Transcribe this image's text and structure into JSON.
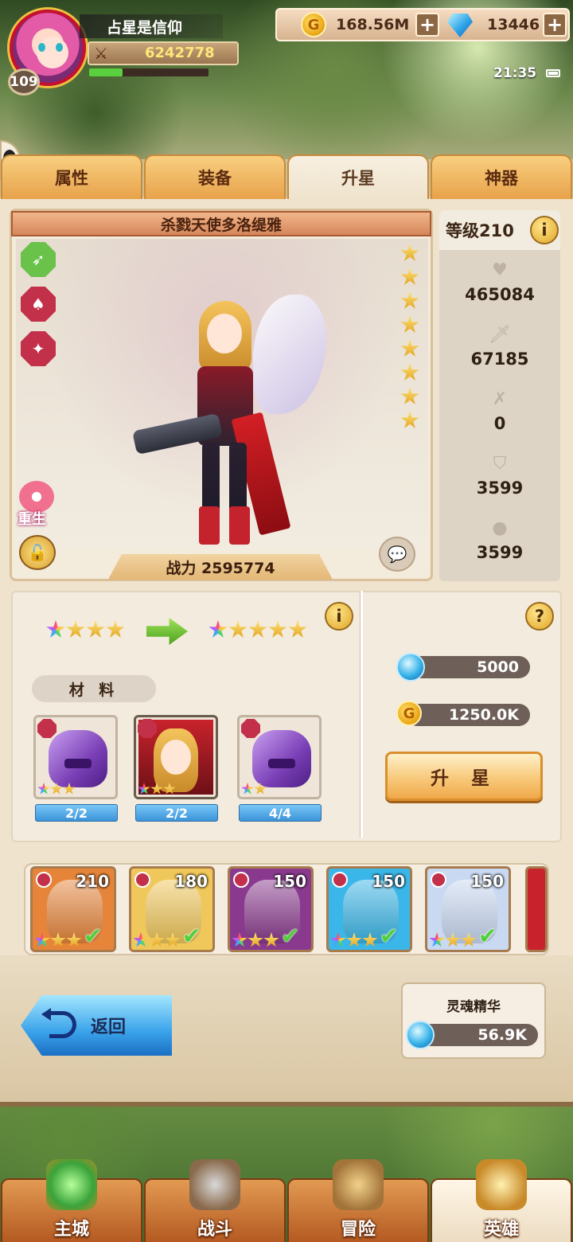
{
  "header": {
    "player_name": "占星是信仰",
    "player_level": "109",
    "combat_power": "6242778",
    "exp_progress": 0.28,
    "gold": "168.56M",
    "gems": "13446",
    "time": "21:35"
  },
  "tabs": [
    {
      "label": "属性"
    },
    {
      "label": "装备"
    },
    {
      "label": "升星"
    },
    {
      "label": "神器"
    }
  ],
  "active_tab": "升星",
  "hero": {
    "name": "杀戮天使多洛缇雅",
    "star_count": 8,
    "combat_power_text": "战力 2595774",
    "rebirth_label": "重生"
  },
  "stats": {
    "level_text": "等级210",
    "hp": "465084",
    "attack": "67185",
    "armor_pen": "0",
    "defense": "3599",
    "magic_def": "3599"
  },
  "upgrade": {
    "current_stars": 4,
    "next_stars": 5,
    "materials_label": "材 料",
    "materials": [
      {
        "type": "helmet",
        "count": "2/2"
      },
      {
        "type": "hero",
        "count": "2/2"
      },
      {
        "type": "helmet",
        "count": "4/4"
      }
    ],
    "soul_cost": "5000",
    "gold_cost": "1250.0K",
    "button_label": "升 星"
  },
  "roster": [
    {
      "level": "210",
      "bg": "#e6853a"
    },
    {
      "level": "180",
      "bg": "#f0c75a"
    },
    {
      "level": "150",
      "bg": "#8a3a8e"
    },
    {
      "level": "150",
      "bg": "#3ab6e8"
    },
    {
      "level": "150",
      "bg": "#c9d9f2"
    }
  ],
  "bottom": {
    "back_label": "返回",
    "soul_essence_label": "灵魂精华",
    "soul_essence_value": "56.9K"
  },
  "nav": [
    {
      "label": "主城"
    },
    {
      "label": "战斗"
    },
    {
      "label": "冒险"
    },
    {
      "label": "英雄"
    }
  ]
}
